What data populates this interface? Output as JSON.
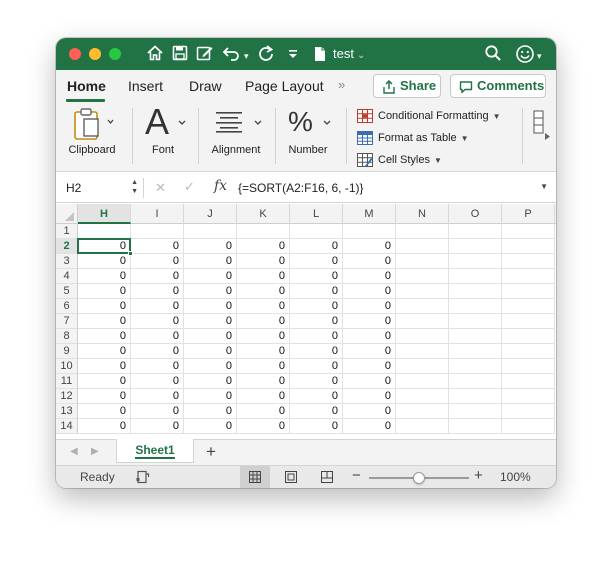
{
  "window": {
    "title": "test",
    "titlebar_icons": [
      "home-icon",
      "save-icon",
      "edit-icon",
      "undo-icon",
      "redo-icon",
      "customize-icon"
    ],
    "search_icon": "search-icon",
    "account_icon": "smiley-icon"
  },
  "ribbon": {
    "tabs": [
      {
        "label": "Home",
        "active": true
      },
      {
        "label": "Insert",
        "active": false
      },
      {
        "label": "Draw",
        "active": false
      },
      {
        "label": "Page Layout",
        "active": false
      }
    ],
    "more_tabs": "»",
    "share_label": "Share",
    "comments_label": "Comments",
    "groups": [
      {
        "label": "Clipboard",
        "icon": "clipboard-icon"
      },
      {
        "label": "Font",
        "icon": "font-icon",
        "glyph": "A"
      },
      {
        "label": "Alignment",
        "icon": "alignment-icon"
      },
      {
        "label": "Number",
        "icon": "percent-icon",
        "glyph": "%"
      }
    ],
    "styles": [
      {
        "label": "Conditional Formatting",
        "icon": "conditional-formatting-icon"
      },
      {
        "label": "Format as Table",
        "icon": "format-table-icon"
      },
      {
        "label": "Cell Styles",
        "icon": "cell-styles-icon"
      }
    ]
  },
  "formula_bar": {
    "name_box": "H2",
    "fx_label": "fx",
    "formula": "{=SORT(A2:F16, 6, -1)}"
  },
  "grid": {
    "columns": [
      "H",
      "I",
      "J",
      "K",
      "L",
      "M",
      "N",
      "O",
      "P"
    ],
    "selected_column": "H",
    "rows": [
      {
        "num": "1",
        "cells": [
          "",
          "",
          "",
          "",
          "",
          "",
          "",
          "",
          ""
        ]
      },
      {
        "num": "2",
        "cells": [
          "0",
          "0",
          "0",
          "0",
          "0",
          "0",
          "",
          "",
          ""
        ]
      },
      {
        "num": "3",
        "cells": [
          "0",
          "0",
          "0",
          "0",
          "0",
          "0",
          "",
          "",
          ""
        ]
      },
      {
        "num": "4",
        "cells": [
          "0",
          "0",
          "0",
          "0",
          "0",
          "0",
          "",
          "",
          ""
        ]
      },
      {
        "num": "5",
        "cells": [
          "0",
          "0",
          "0",
          "0",
          "0",
          "0",
          "",
          "",
          ""
        ]
      },
      {
        "num": "6",
        "cells": [
          "0",
          "0",
          "0",
          "0",
          "0",
          "0",
          "",
          "",
          ""
        ]
      },
      {
        "num": "7",
        "cells": [
          "0",
          "0",
          "0",
          "0",
          "0",
          "0",
          "",
          "",
          ""
        ]
      },
      {
        "num": "8",
        "cells": [
          "0",
          "0",
          "0",
          "0",
          "0",
          "0",
          "",
          "",
          ""
        ]
      },
      {
        "num": "9",
        "cells": [
          "0",
          "0",
          "0",
          "0",
          "0",
          "0",
          "",
          "",
          ""
        ]
      },
      {
        "num": "10",
        "cells": [
          "0",
          "0",
          "0",
          "0",
          "0",
          "0",
          "",
          "",
          ""
        ]
      },
      {
        "num": "11",
        "cells": [
          "0",
          "0",
          "0",
          "0",
          "0",
          "0",
          "",
          "",
          ""
        ]
      },
      {
        "num": "12",
        "cells": [
          "0",
          "0",
          "0",
          "0",
          "0",
          "0",
          "",
          "",
          ""
        ]
      },
      {
        "num": "13",
        "cells": [
          "0",
          "0",
          "0",
          "0",
          "0",
          "0",
          "",
          "",
          ""
        ]
      },
      {
        "num": "14",
        "cells": [
          "0",
          "0",
          "0",
          "0",
          "0",
          "0",
          "",
          "",
          ""
        ]
      }
    ],
    "selected_row": "2"
  },
  "sheets": {
    "tabs": [
      "Sheet1"
    ],
    "add_label": "+"
  },
  "status": {
    "text": "Ready",
    "zoom": "100%",
    "zoom_fraction": 0.5,
    "view_modes": [
      "normal-view-icon",
      "page-layout-view-icon",
      "page-break-view-icon"
    ]
  },
  "colors": {
    "accent": "#217346",
    "close": "#ff5f57",
    "minimize": "#febc2e",
    "maximize": "#28c840"
  }
}
